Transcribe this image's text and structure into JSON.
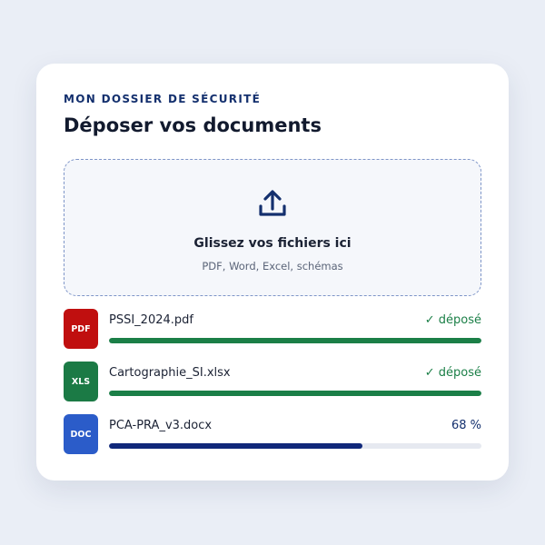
{
  "header": {
    "eyebrow": "MON DOSSIER DE SÉCURITÉ",
    "title": "Déposer vos documents"
  },
  "dropzone": {
    "icon": "upload-icon",
    "title": "Glissez vos fichiers ici",
    "subtitle": "PDF, Word, Excel, schémas"
  },
  "files": [
    {
      "type": "PDF",
      "name": "PSSI_2024.pdf",
      "status": "✓ déposé",
      "progress": 100,
      "badge_color": "#c00f0f",
      "bar_color": "#1b7f47",
      "status_color": "#1b7f47"
    },
    {
      "type": "XLS",
      "name": "Cartographie_SI.xlsx",
      "status": "✓ déposé",
      "progress": 100,
      "badge_color": "#1b7a45",
      "bar_color": "#1b7f47",
      "status_color": "#1b7f47"
    },
    {
      "type": "DOC",
      "name": "PCA-PRA_v3.docx",
      "status": "68 %",
      "progress": 68,
      "badge_color": "#2b5cc9",
      "bar_color": "#10287a",
      "status_color": "#14306e"
    }
  ],
  "colors": {
    "accent": "#14306e",
    "success": "#1b7f47",
    "track": "#e6e9f0",
    "background": "#eaeef6"
  }
}
